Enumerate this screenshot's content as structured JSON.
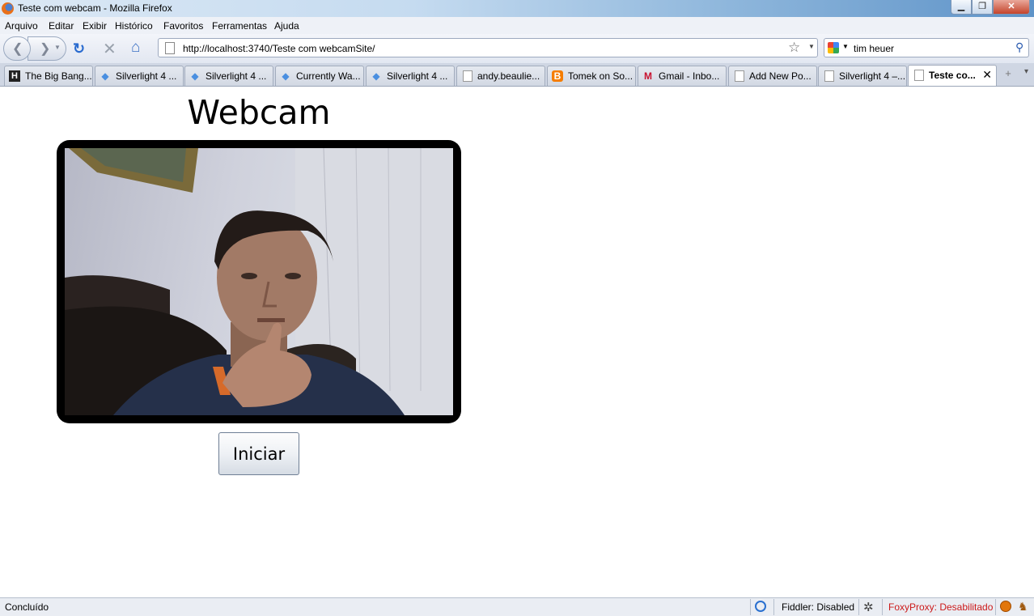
{
  "window": {
    "title": "Teste com webcam - Mozilla Firefox"
  },
  "menu": [
    "Arquivo",
    "Editar",
    "Exibir",
    "Histórico",
    "Favoritos",
    "Ferramentas",
    "Ajuda"
  ],
  "navigation": {
    "url": "http://localhost:3740/Teste com webcamSite/",
    "search_value": "tim heuer"
  },
  "tabs": [
    {
      "label": "The Big Bang...",
      "icon": "bigbang-icon"
    },
    {
      "label": "Silverlight 4 ...",
      "icon": "silverlight-icon"
    },
    {
      "label": "Silverlight 4 ...",
      "icon": "silverlight-icon"
    },
    {
      "label": "Currently Wa...",
      "icon": "silverlight-icon"
    },
    {
      "label": "Silverlight 4 ...",
      "icon": "silverlight-icon"
    },
    {
      "label": "andy.beaulie...",
      "icon": "page-icon"
    },
    {
      "label": "Tomek on So...",
      "icon": "blogger-icon"
    },
    {
      "label": "Gmail - Inbo...",
      "icon": "gmail-icon"
    },
    {
      "label": "Add New Po...",
      "icon": "page-icon"
    },
    {
      "label": "Silverlight 4 –...",
      "icon": "page-icon"
    },
    {
      "label": "Teste co...",
      "icon": "page-icon",
      "active": true
    }
  ],
  "page": {
    "heading": "Webcam",
    "button_label": "Iniciar"
  },
  "status": {
    "text": "Concluído",
    "fiddler": "Fiddler: Disabled",
    "foxyproxy": "FoxyProxy: Desabilitado"
  }
}
